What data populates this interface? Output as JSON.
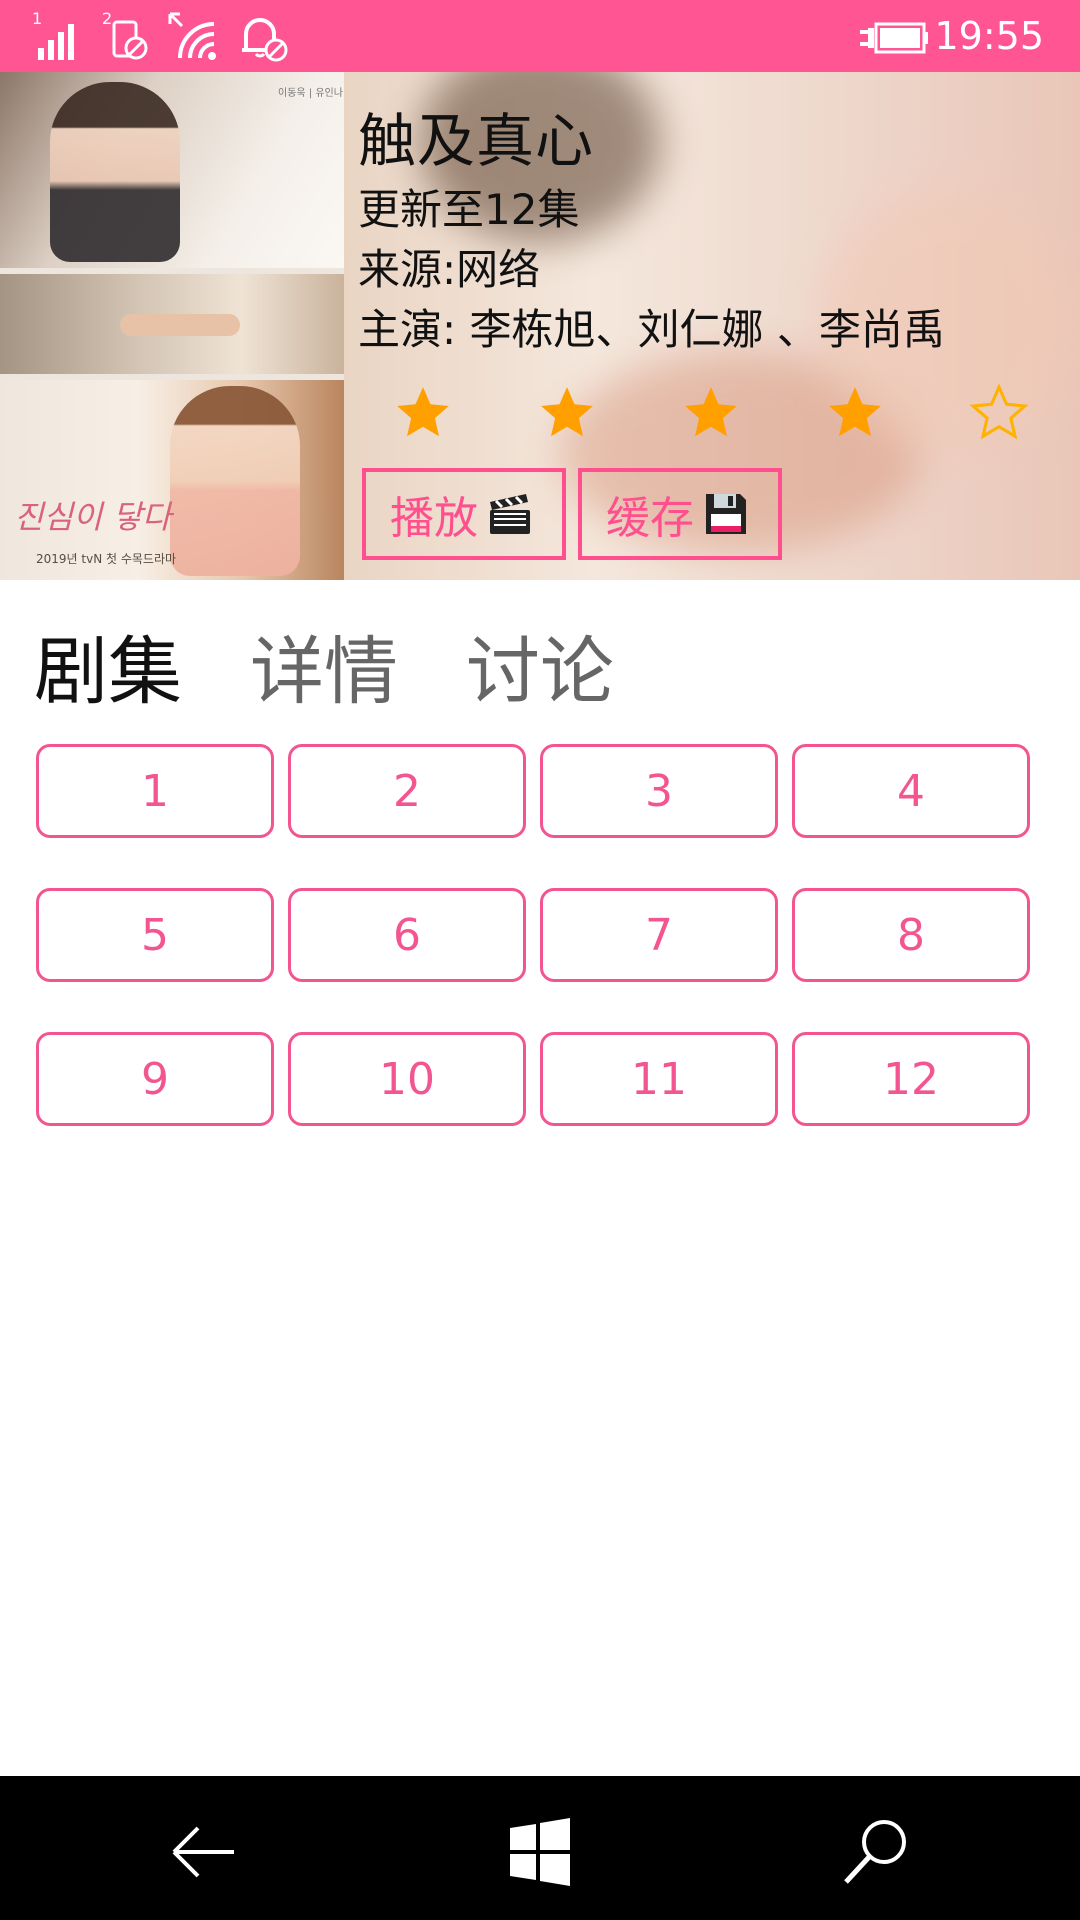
{
  "status_bar": {
    "time": "19:55",
    "icons": [
      "sim1-signal-icon",
      "sim2-no-data-icon",
      "wifi-icon",
      "quiet-hours-icon",
      "battery-charging-icon"
    ]
  },
  "show": {
    "title": "触及真心",
    "update": "更新至12集",
    "source": "来源:网络",
    "cast": "主演: 李栋旭、刘仁娜 、李尚禹",
    "rating_filled": 4,
    "rating_max": 5,
    "poster_caption": "진심이 닿다",
    "poster_sub": "2019년 tvN 첫 수목드라마",
    "poster_top": "이동욱 | 유인나"
  },
  "actions": {
    "play_label": "播放",
    "cache_label": "缓存"
  },
  "tabs": [
    {
      "label": "剧集",
      "active": true
    },
    {
      "label": "详情",
      "active": false
    },
    {
      "label": "讨论",
      "active": false
    }
  ],
  "episodes": [
    "1",
    "2",
    "3",
    "4",
    "5",
    "6",
    "7",
    "8",
    "9",
    "10",
    "11",
    "12"
  ],
  "colors": {
    "accent": "#ff5592",
    "star": "#ffa500",
    "nav_bg": "#000000"
  }
}
